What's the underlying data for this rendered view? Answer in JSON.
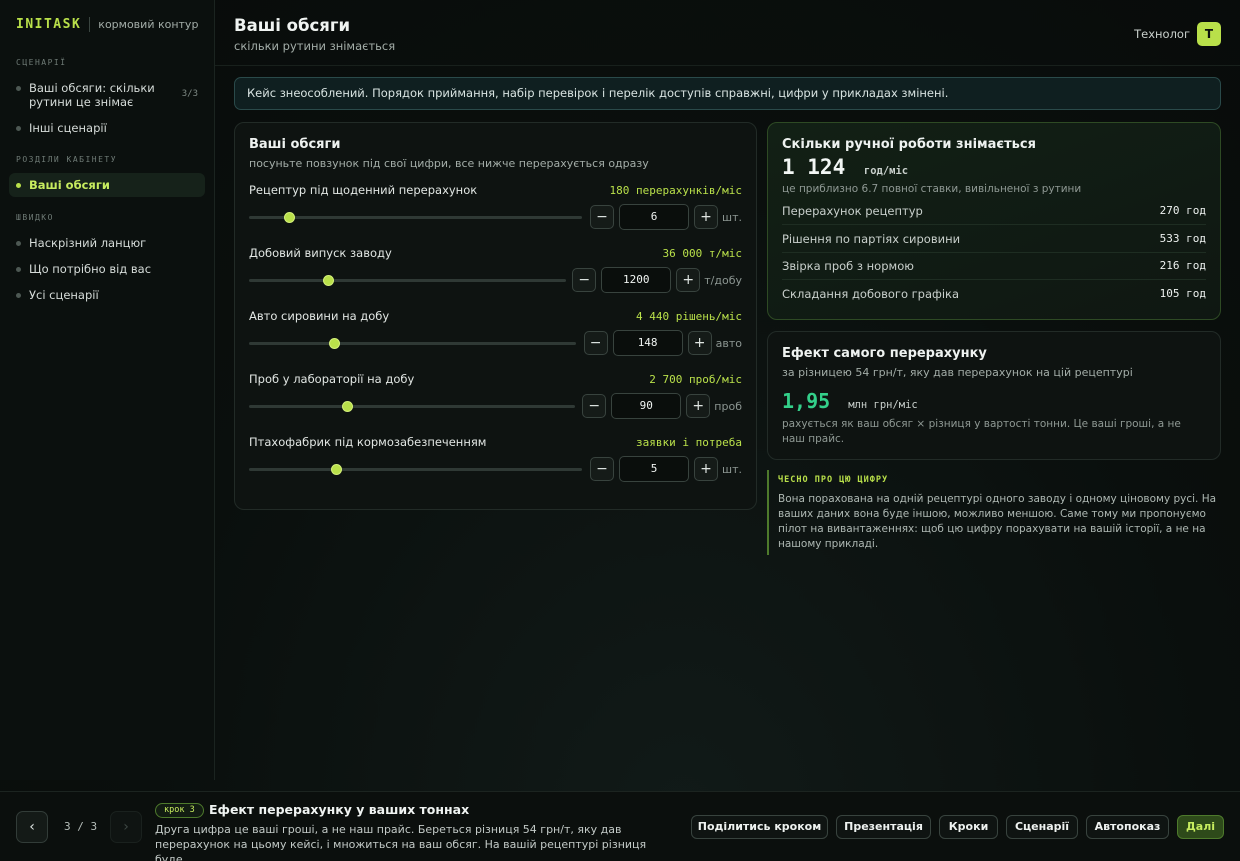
{
  "brand": {
    "name": "INITASK",
    "subtitle": "кормовий контур"
  },
  "sidebar": {
    "scenarios_label": "СЦЕНАРІЇ",
    "scenarios": [
      {
        "label": "Ваші обсяги: скільки рутини це знімає",
        "count": "3/3"
      },
      {
        "label": "Інші сценарії"
      }
    ],
    "cabinet_label": "РОЗДІЛИ КАБІНЕТУ",
    "cabinet_items": [
      {
        "label": "Ваші обсяги"
      }
    ],
    "quick_label": "ШВИДКО",
    "quick_items": [
      {
        "label": "Наскрізний ланцюг"
      },
      {
        "label": "Що потрібно від вас"
      },
      {
        "label": "Усі сценарії"
      }
    ]
  },
  "header": {
    "title": "Ваші обсяги",
    "subtitle": "скільки рутини знімається",
    "role": "Технолог",
    "avatar": "Т"
  },
  "banner": {
    "text": "Кейс знеособлений. Порядок приймання, набір перевірок і перелік доступів справжні, цифри у прикладах змінені."
  },
  "volumes": {
    "title": "Ваші обсяги",
    "subtitle": "посуньте повзунок під свої цифри, все нижче перерахується одразу",
    "rows": [
      {
        "label": "Рецептур під щоденний перерахунок",
        "value_text": "180 перерахунків/міс",
        "input": "6",
        "unit": "шт.",
        "level": 0.12
      },
      {
        "label": "Добовий випуск заводу",
        "value_text": "36 000 т/міс",
        "input": "1200",
        "unit": "т/добу",
        "level": 0.25
      },
      {
        "label": "Авто сировини на добу",
        "value_text": "4 440 рішень/міс",
        "input": "148",
        "unit": "авто",
        "level": 0.26
      },
      {
        "label": "Проб у лабораторії на добу",
        "value_text": "2 700 проб/міс",
        "input": "90",
        "unit": "проб",
        "level": 0.3
      },
      {
        "label": "Птахофабрик під кормозабезпеченням",
        "value_text": "заявки і потреба",
        "input": "5",
        "unit": "шт.",
        "level": 0.26
      }
    ],
    "minus": "−",
    "plus": "+"
  },
  "manual": {
    "title": "Скільки ручної роботи знімається",
    "total": "1 124",
    "total_unit": "год/міс",
    "note": "це приблизно 6.7 повної ставки, вивільненої з рутини",
    "items": [
      {
        "label": "Перерахунок рецептур",
        "value": "270 год"
      },
      {
        "label": "Рішення по партіях сировини",
        "value": "533 год"
      },
      {
        "label": "Звірка проб з нормою",
        "value": "216 год"
      },
      {
        "label": "Складання добового графіка",
        "value": "105 год"
      }
    ]
  },
  "effect": {
    "title": "Ефект самого перерахунку",
    "subtitle": "за різницею 54 грн/т, яку дав перерахунок на цій рецептурі",
    "value": "1,95",
    "unit": "млн грн/міс",
    "note": "рахується як ваш обсяг × різниця у вартості тонни. Це ваші гроші, а не наш прайс."
  },
  "honest": {
    "title": "ЧЕСНО ПРО ЦЮ ЦИФРУ",
    "text": "Вона порахована на одній рецептурі одного заводу і одному ціновому русі. На ваших даних вона буде іншою, можливо меншою. Саме тому ми пропонуємо пілот на вивантаженнях: щоб цю цифру порахувати на вашій історії, а не на нашому прикладі."
  },
  "footer": {
    "prev": "‹",
    "next": "›",
    "pager": "3 / 3",
    "step_pill": "крок 3",
    "step_title": "Ефект перерахунку у ваших тоннах",
    "step_desc": "Друга цифра це ваші гроші, а не наш прайс. Береться різниця 54 грн/т, яку дав перерахунок на цьому кейсі, і множиться на ваш обсяг. На вашій рецептурі різниця буде…",
    "actions": [
      "Поділитись кроком",
      "Презентація",
      "Кроки",
      "Сценарії",
      "Автопоказ",
      "Далі"
    ]
  }
}
